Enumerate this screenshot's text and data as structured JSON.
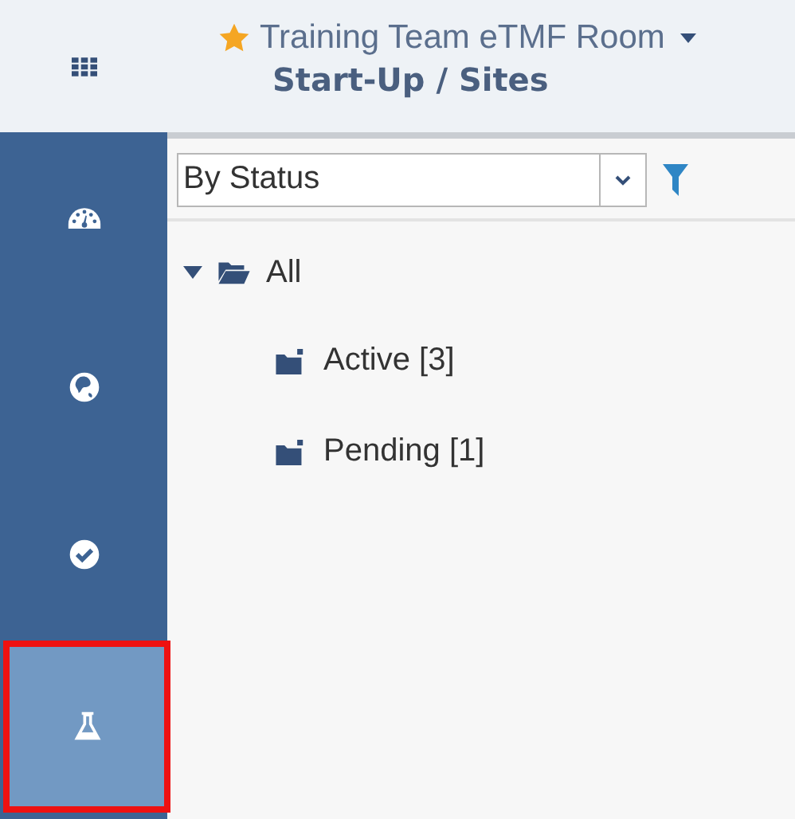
{
  "header": {
    "room": "Training Team eTMF Room",
    "favorite": true,
    "page_title": "Start-Up / Sites"
  },
  "nav": [
    {
      "kind": "dashboard",
      "selected": false
    },
    {
      "kind": "globe",
      "selected": false
    },
    {
      "kind": "check",
      "selected": false
    },
    {
      "kind": "flask",
      "selected": true,
      "highlighted": true
    }
  ],
  "filter": {
    "value": "By Status"
  },
  "tree": [
    {
      "label": "All",
      "expanded": true,
      "children": [
        {
          "label": "Active [3]"
        },
        {
          "label": "Pending [1]"
        }
      ]
    }
  ]
}
